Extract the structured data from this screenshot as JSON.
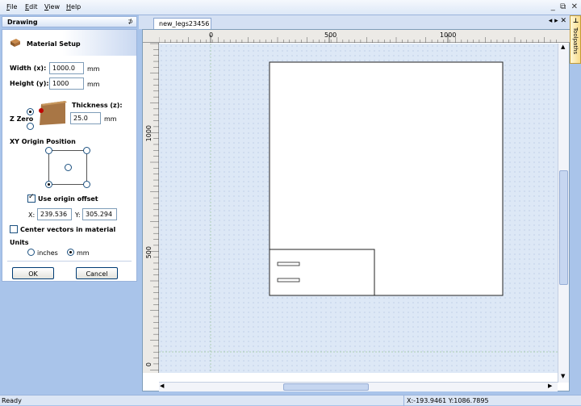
{
  "menubar": {
    "items": [
      "File",
      "Edit",
      "View",
      "Help"
    ]
  },
  "panel": {
    "title": "Drawing",
    "pin": "⊅",
    "material_setup": {
      "heading": "Material Setup",
      "width_label": "Width (x):",
      "width_value": "1000.0",
      "width_unit": "mm",
      "height_label": "Height (y):",
      "height_value": "1000",
      "height_unit": "mm",
      "thickness_label": "Thickness (z):",
      "thickness_value": "25.0",
      "thickness_unit": "mm",
      "zzero_label": "Z Zero",
      "origin_heading": "XY Origin Position",
      "use_offset_label": "Use origin offset",
      "x_label": "X:",
      "x_value": "239.536",
      "y_label": "Y:",
      "y_value": "305.294",
      "center_vectors_label": "Center vectors in material",
      "units_heading": "Units",
      "unit_inches": "inches",
      "unit_mm": "mm",
      "ok": "OK",
      "cancel": "Cancel"
    }
  },
  "document": {
    "tab_title": "new_legs23456",
    "tab_ctrls": "◂ ▸ ✕",
    "ruler_top_labels": [
      "0",
      "500",
      "1000"
    ],
    "ruler_left_labels": [
      "1000",
      "500",
      "0"
    ]
  },
  "sidebar_right": {
    "toolpaths_label": "Toolpaths"
  },
  "status": {
    "ready": "Ready",
    "coords": "X:-193.9461 Y:1086.7895"
  },
  "colors": {
    "accent": "#316ac5",
    "panel_border": "#9ab4dc",
    "work_bg": "#dde8f6"
  }
}
